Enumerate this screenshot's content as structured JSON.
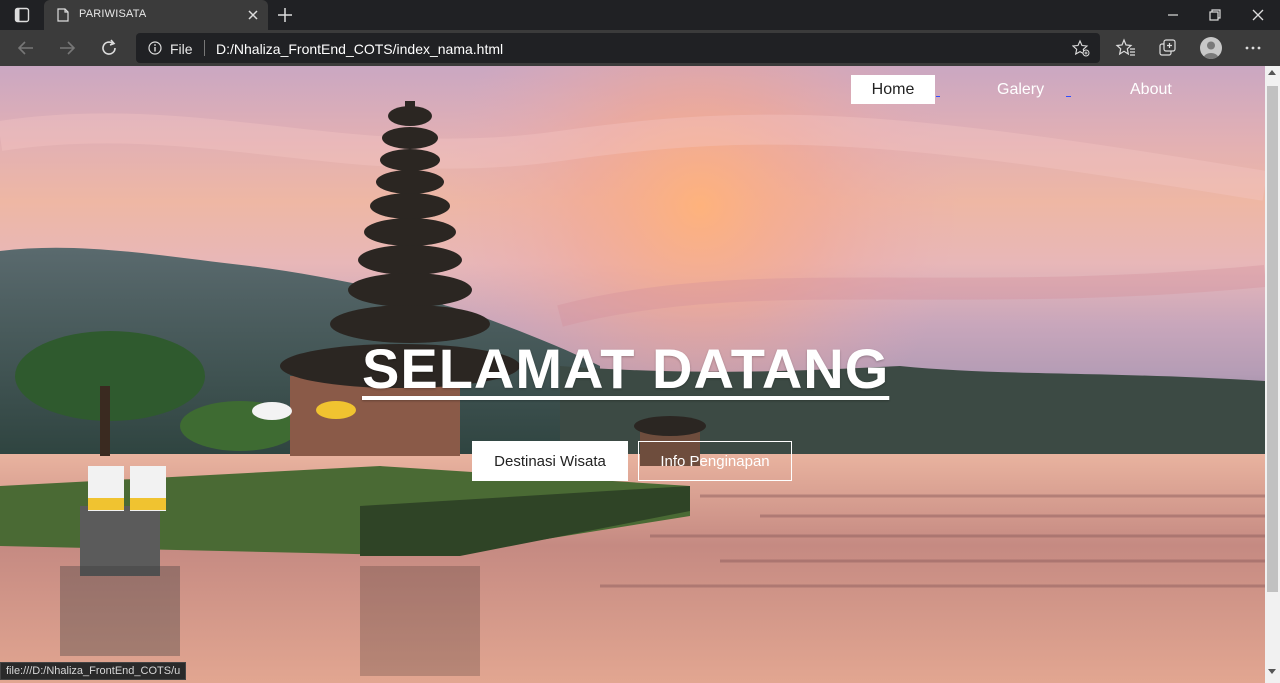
{
  "browser": {
    "tab_title": "PARIWISATA",
    "address_scheme": "File",
    "address_url": "D:/Nhaliza_FrontEnd_COTS/index_nama.html",
    "status_url": "file:///D:/Nhaliza_FrontEnd_COTS/u"
  },
  "nav": {
    "home": "Home",
    "galery": "Galery",
    "about": "About"
  },
  "hero": {
    "title": "SELAMAT DATANG",
    "primary_button": "Destinasi Wisata",
    "secondary_button": "Info Penginapan"
  },
  "colors": {
    "chrome_dark": "#202124",
    "chrome_toolbar": "#3b3b3b",
    "nav_underline": "#2f4dff"
  }
}
